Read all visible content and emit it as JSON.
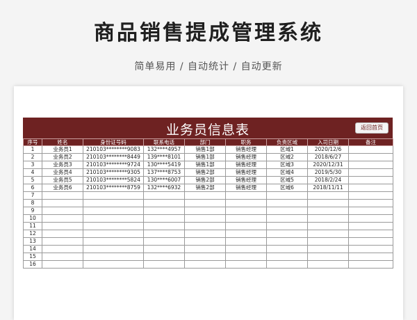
{
  "header": {
    "title": "商品销售提成管理系统",
    "subtitle": "简单易用  /  自动统计  /  自动更新"
  },
  "sheet": {
    "title": "业务员信息表",
    "back_button": "返回首页",
    "columns": [
      "序号",
      "姓名",
      "身份证号码",
      "联系电话",
      "部门",
      "职务",
      "负责区域",
      "入司日期",
      "备注"
    ],
    "rows": [
      [
        "1",
        "业务员1",
        "210103********9083",
        "132****4957",
        "销售1部",
        "销售经理",
        "区域1",
        "2020/12/6",
        ""
      ],
      [
        "2",
        "业务员2",
        "210103********8449",
        "139****8101",
        "销售1部",
        "销售经理",
        "区域2",
        "2018/6/27",
        ""
      ],
      [
        "3",
        "业务员3",
        "210103********9724",
        "130****5419",
        "销售1部",
        "销售经理",
        "区域3",
        "2020/12/31",
        ""
      ],
      [
        "4",
        "业务员4",
        "210103********9305",
        "137****8753",
        "销售2部",
        "销售经理",
        "区域4",
        "2019/5/30",
        ""
      ],
      [
        "5",
        "业务员5",
        "210103********5824",
        "130****6007",
        "销售2部",
        "销售经理",
        "区域5",
        "2018/2/24",
        ""
      ],
      [
        "6",
        "业务员6",
        "210103********8759",
        "132****6932",
        "销售2部",
        "销售经理",
        "区域6",
        "2018/11/11",
        ""
      ],
      [
        "7",
        "",
        "",
        "",
        "",
        "",
        "",
        "",
        ""
      ],
      [
        "8",
        "",
        "",
        "",
        "",
        "",
        "",
        "",
        ""
      ],
      [
        "9",
        "",
        "",
        "",
        "",
        "",
        "",
        "",
        ""
      ],
      [
        "10",
        "",
        "",
        "",
        "",
        "",
        "",
        "",
        ""
      ],
      [
        "11",
        "",
        "",
        "",
        "",
        "",
        "",
        "",
        ""
      ],
      [
        "12",
        "",
        "",
        "",
        "",
        "",
        "",
        "",
        ""
      ],
      [
        "13",
        "",
        "",
        "",
        "",
        "",
        "",
        "",
        ""
      ],
      [
        "14",
        "",
        "",
        "",
        "",
        "",
        "",
        "",
        ""
      ],
      [
        "15",
        "",
        "",
        "",
        "",
        "",
        "",
        "",
        ""
      ],
      [
        "16",
        "",
        "",
        "",
        "",
        "",
        "",
        "",
        ""
      ]
    ]
  },
  "colors": {
    "accent": "#6e2222",
    "background": "#f4f4f4"
  }
}
